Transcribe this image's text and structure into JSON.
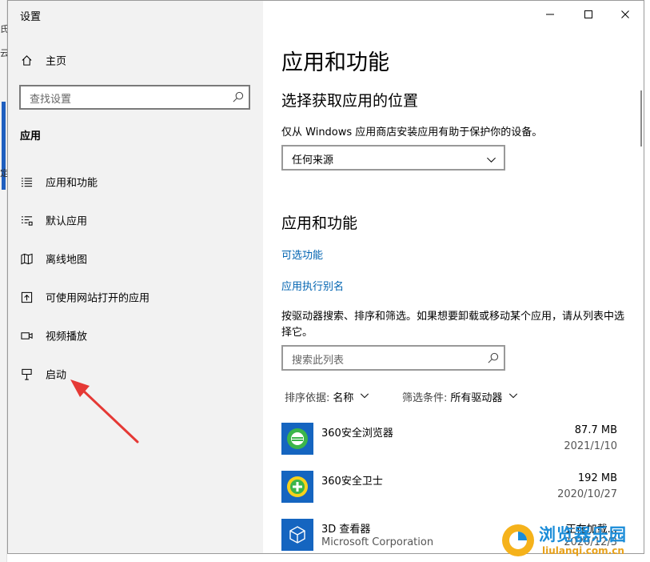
{
  "window": {
    "title": "设置"
  },
  "background": {
    "fragments": [
      "氏",
      "云",
      "定"
    ]
  },
  "sidebar": {
    "home_label": "主页",
    "search_placeholder": "查找设置",
    "section": "应用",
    "items": [
      {
        "label": "应用和功能",
        "icon": "list-icon"
      },
      {
        "label": "默认应用",
        "icon": "default-apps-icon"
      },
      {
        "label": "离线地图",
        "icon": "map-icon"
      },
      {
        "label": "可使用网站打开的应用",
        "icon": "web-open-icon"
      },
      {
        "label": "视频播放",
        "icon": "video-icon"
      },
      {
        "label": "启动",
        "icon": "startup-icon"
      }
    ]
  },
  "content": {
    "page_title": "应用和功能",
    "install_section": {
      "heading": "选择获取应用的位置",
      "description": "仅从 Windows 应用商店安装应用有助于保护你的设备。",
      "selected_source": "任何来源"
    },
    "apps_section": {
      "heading": "应用和功能",
      "optional_features_link": "可选功能",
      "app_alias_link": "应用执行别名",
      "description": "按驱动器搜索、排序和筛选。如果想要卸载或移动某个应用，请从列表中选择它。",
      "search_placeholder": "搜索此列表",
      "sort_label": "排序依据:",
      "sort_value": "名称",
      "filter_label": "筛选条件:",
      "filter_value": "所有驱动器"
    },
    "apps": [
      {
        "name": "360安全浏览器",
        "publisher": "",
        "size": "87.7 MB",
        "date": "2021/1/10",
        "tile_color": "#1565c0"
      },
      {
        "name": "360安全卫士",
        "publisher": "",
        "size": "192 MB",
        "date": "2020/10/27",
        "tile_color": "#1565c0"
      },
      {
        "name": "3D 查看器",
        "publisher": "Microsoft Corporation",
        "size": "正在加载...",
        "date": "2020/12/3",
        "tile_color": "#1565c0"
      }
    ]
  },
  "watermark": {
    "title": "浏览器乐园",
    "url": "liulanqi.com.cn"
  },
  "colors": {
    "accent": "#0063b1",
    "annotation_arrow": "#e53935"
  }
}
